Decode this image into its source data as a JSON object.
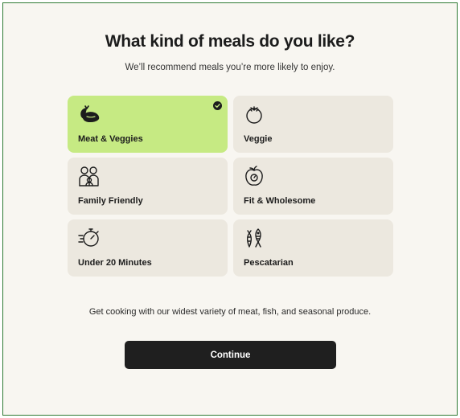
{
  "header": {
    "title": "What kind of meals do you like?",
    "subtitle": "We’ll recommend meals you’re more likely to enjoy."
  },
  "options": [
    {
      "label": "Meat & Veggies",
      "icon": "meat-veggies-icon",
      "selected": true
    },
    {
      "label": "Veggie",
      "icon": "tomato-icon",
      "selected": false
    },
    {
      "label": "Family Friendly",
      "icon": "family-icon",
      "selected": false
    },
    {
      "label": "Fit & Wholesome",
      "icon": "apple-scale-icon",
      "selected": false
    },
    {
      "label": "Under 20 Minutes",
      "icon": "stopwatch-icon",
      "selected": false
    },
    {
      "label": "Pescatarian",
      "icon": "fish-carrot-icon",
      "selected": false
    }
  ],
  "description": "Get cooking with our widest variety of meat, fish, and seasonal produce.",
  "continue_label": "Continue",
  "colors": {
    "selected_card": "#c6ea83",
    "card": "#ece8df",
    "background": "#f8f6f1",
    "button": "#1f1f1f"
  }
}
